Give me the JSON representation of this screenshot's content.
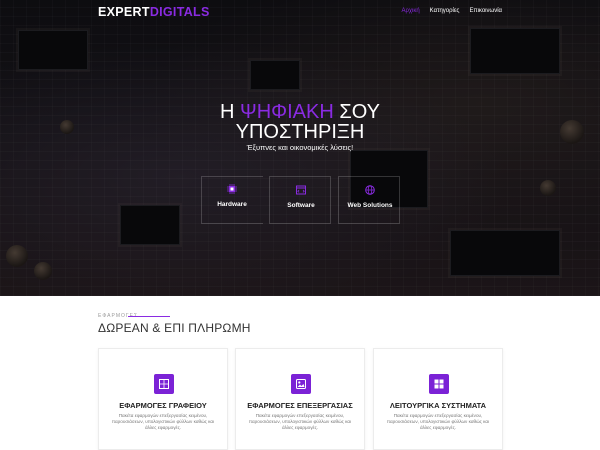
{
  "brand": {
    "logo_main": "EXPERT",
    "logo_accent": "DIGITALS",
    "accent_color": "#8a2be2"
  },
  "nav": {
    "items": [
      {
        "label": "Αρχική",
        "active": true
      },
      {
        "label": "Κατηγορίες",
        "active": false
      },
      {
        "label": "Επικοινωνία",
        "active": false
      }
    ]
  },
  "hero": {
    "headline_pre": "Η",
    "headline_highlight": "ΨΗΦΙΑΚΗ",
    "headline_post": "ΣΟΥ",
    "headline_line2": "ΥΠΟΣΤΗΡΙΞΗ",
    "tagline": "Έξυπνες και οικονομικές λύσεις!",
    "services": [
      {
        "label": "Hardware",
        "icon": "chip-icon"
      },
      {
        "label": "Software",
        "icon": "software-icon"
      },
      {
        "label": "Web Solutions",
        "icon": "globe-icon"
      }
    ]
  },
  "apps": {
    "kicker": "ΕΦΑΡΜΟΓΕΣ",
    "title": "ΔΩΡΕΑΝ & ΕΠΙ ΠΛΗΡΩΜΗ",
    "cards": [
      {
        "title": "ΕΦΑΡΜΟΓΕΣ ΓΡΑΦΕΙΟΥ",
        "description": "Πακέτα εφαρμογών επεξεργασίας κειμένου, παρουσιάσεων, υπολογιστικών φύλλων καθώς και άλλες εφαρμογές.",
        "icon": "office-icon"
      },
      {
        "title": "ΕΦΑΡΜΟΓΕΣ ΕΠΕΞΕΡΓΑΣΙΑΣ",
        "description": "Πακέτα εφαρμογών επεξεργασίας κειμένου, παρουσιάσεων, υπολογιστικών φύλλων καθώς και άλλες εφαρμογές.",
        "icon": "editing-icon"
      },
      {
        "title": "ΛΕΙΤΟΥΡΓΙΚΑ ΣΥΣΤΗΜΑΤΑ",
        "description": "Πακέτα εφαρμογών επεξεργασίας κειμένου, παρουσιάσεων, υπολογιστικών φύλλων καθώς και άλλες εφαρμογές.",
        "icon": "os-icon"
      }
    ]
  }
}
